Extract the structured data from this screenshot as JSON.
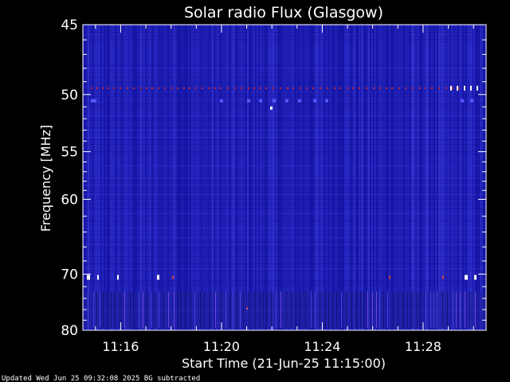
{
  "chart_data": {
    "type": "heatmap",
    "title": "Solar radio Flux (Glasgow)",
    "xlabel": "Start Time (21-Jun-25 11:15:00)",
    "ylabel": "Frequency [MHz]",
    "x_range": [
      "11:14:30",
      "11:30:30"
    ],
    "y_range_mhz": [
      45,
      80
    ],
    "x_ticks": [
      {
        "label": "11:16",
        "minutes": 16
      },
      {
        "label": "11:20",
        "minutes": 20
      },
      {
        "label": "11:24",
        "minutes": 24
      },
      {
        "label": "11:28",
        "minutes": 28
      }
    ],
    "y_ticks": [
      {
        "label": "45",
        "value": 45
      },
      {
        "label": "50",
        "value": 50
      },
      {
        "label": "55",
        "value": 55
      },
      {
        "label": "60",
        "value": 60
      },
      {
        "label": "70",
        "value": 70
      },
      {
        "label": "80",
        "value": 80
      }
    ],
    "y_scale": "reciprocal",
    "colormap": [
      "#000060",
      "#1414b4",
      "#3030e0",
      "#ff2020",
      "#ffffff"
    ],
    "background_color": "#1c1cae",
    "interference_bands_mhz": [
      49.5,
      50.5,
      70.5
    ],
    "footer": "Updated Wed Jun 25 09:32:08 2025   BG subtracted"
  }
}
